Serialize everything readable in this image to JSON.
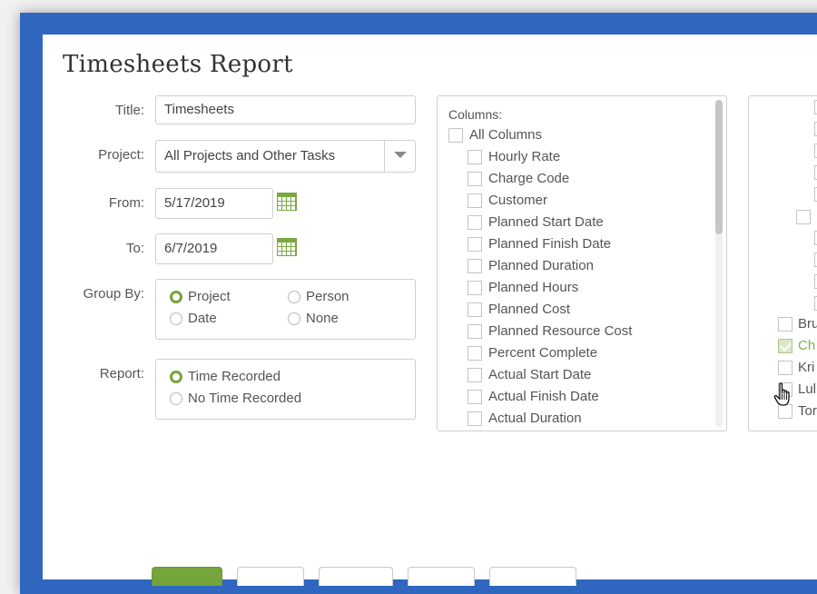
{
  "dialog": {
    "title": "Timesheets Report"
  },
  "form": {
    "title_label": "Title:",
    "title_value": "Timesheets",
    "project_label": "Project:",
    "project_value": "All Projects and Other Tasks",
    "from_label": "From:",
    "from_value": "5/17/2019",
    "to_label": "To:",
    "to_value": "6/7/2019",
    "group_by_label": "Group By:",
    "group_by_options": [
      "Project",
      "Person",
      "Date",
      "None"
    ],
    "group_by_selected": "Project",
    "report_label": "Report:",
    "report_options": [
      "Time Recorded",
      "No Time Recorded"
    ],
    "report_selected": "Time Recorded"
  },
  "columns": {
    "heading": "Columns:",
    "all_label": "All Columns",
    "items": [
      "Hourly Rate",
      "Charge Code",
      "Customer",
      "Planned Start Date",
      "Planned Finish Date",
      "Planned Duration",
      "Planned Hours",
      "Planned Cost",
      "Planned Resource Cost",
      "Percent Complete",
      "Actual Start Date",
      "Actual Finish Date",
      "Actual Duration"
    ]
  },
  "people": {
    "items": [
      {
        "label": "Bru",
        "checked": false
      },
      {
        "label": "Ch",
        "checked": true
      },
      {
        "label": "Kri",
        "checked": false
      },
      {
        "label": "Lul",
        "checked": false
      },
      {
        "label": "Tor",
        "checked": false
      }
    ]
  },
  "colors": {
    "frame": "#2f66bf",
    "accent": "#74a43c"
  },
  "icons": {
    "calendar": "calendar-icon",
    "dropdown": "chevron-down-icon",
    "cursor": "hand-cursor-icon"
  }
}
